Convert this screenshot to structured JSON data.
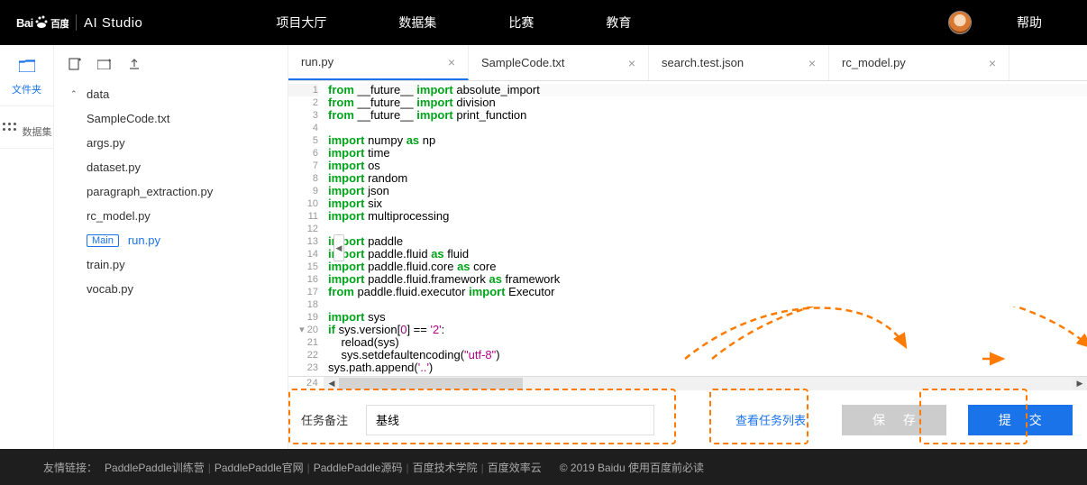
{
  "nav": {
    "logo_baidu": "Bai",
    "logo_baidu2": "百度",
    "logo_studio": "AI Studio",
    "items": [
      "项目大厅",
      "数据集",
      "比赛",
      "教育"
    ],
    "help": "帮助"
  },
  "sidebar_left": {
    "files": "文件夹",
    "datasets": "数据集"
  },
  "file_tree": {
    "folder": "data",
    "files": [
      "SampleCode.txt",
      "args.py",
      "dataset.py",
      "paragraph_extraction.py",
      "rc_model.py",
      "run.py",
      "train.py",
      "vocab.py"
    ],
    "main_badge": "Main",
    "active_index": 5
  },
  "tabs": [
    {
      "label": "run.py",
      "active": true
    },
    {
      "label": "SampleCode.txt",
      "active": false
    },
    {
      "label": "search.test.json",
      "active": false
    },
    {
      "label": "rc_model.py",
      "active": false
    }
  ],
  "code_lines": [
    {
      "n": 1,
      "t": [
        [
          "kw",
          "from"
        ],
        [
          "",
          " __future__ "
        ],
        [
          "kw",
          "import"
        ],
        [
          "",
          " absolute_import"
        ]
      ],
      "hl": true
    },
    {
      "n": 2,
      "t": [
        [
          "kw",
          "from"
        ],
        [
          "",
          " __future__ "
        ],
        [
          "kw",
          "import"
        ],
        [
          "",
          " division"
        ]
      ]
    },
    {
      "n": 3,
      "t": [
        [
          "kw",
          "from"
        ],
        [
          "",
          " __future__ "
        ],
        [
          "kw",
          "import"
        ],
        [
          "",
          " print_function"
        ]
      ]
    },
    {
      "n": 4,
      "t": []
    },
    {
      "n": 5,
      "t": [
        [
          "kw",
          "import"
        ],
        [
          "",
          " numpy "
        ],
        [
          "kw",
          "as"
        ],
        [
          "",
          " np"
        ]
      ]
    },
    {
      "n": 6,
      "t": [
        [
          "kw",
          "import"
        ],
        [
          "",
          " time"
        ]
      ]
    },
    {
      "n": 7,
      "t": [
        [
          "kw",
          "import"
        ],
        [
          "",
          " os"
        ]
      ]
    },
    {
      "n": 8,
      "t": [
        [
          "kw",
          "import"
        ],
        [
          "",
          " random"
        ]
      ]
    },
    {
      "n": 9,
      "t": [
        [
          "kw",
          "import"
        ],
        [
          "",
          " json"
        ]
      ]
    },
    {
      "n": 10,
      "t": [
        [
          "kw",
          "import"
        ],
        [
          "",
          " six"
        ]
      ]
    },
    {
      "n": 11,
      "t": [
        [
          "kw",
          "import"
        ],
        [
          "",
          " multiprocessing"
        ]
      ]
    },
    {
      "n": 12,
      "t": []
    },
    {
      "n": 13,
      "t": [
        [
          "kw",
          "import"
        ],
        [
          "",
          " paddle"
        ]
      ]
    },
    {
      "n": 14,
      "t": [
        [
          "kw",
          "import"
        ],
        [
          "",
          " paddle.fluid "
        ],
        [
          "kw",
          "as"
        ],
        [
          "",
          " fluid"
        ]
      ]
    },
    {
      "n": 15,
      "t": [
        [
          "kw",
          "import"
        ],
        [
          "",
          " paddle.fluid.core "
        ],
        [
          "kw",
          "as"
        ],
        [
          "",
          " core"
        ]
      ]
    },
    {
      "n": 16,
      "t": [
        [
          "kw",
          "import"
        ],
        [
          "",
          " paddle.fluid.framework "
        ],
        [
          "kw",
          "as"
        ],
        [
          "",
          " framework"
        ]
      ]
    },
    {
      "n": 17,
      "t": [
        [
          "kw",
          "from"
        ],
        [
          "",
          " paddle.fluid.executor "
        ],
        [
          "kw",
          "import"
        ],
        [
          "",
          " Executor"
        ]
      ]
    },
    {
      "n": 18,
      "t": []
    },
    {
      "n": 19,
      "t": [
        [
          "kw",
          "import"
        ],
        [
          "",
          " sys"
        ]
      ]
    },
    {
      "n": 20,
      "t": [
        [
          "kw",
          "if"
        ],
        [
          "",
          " sys.version["
        ],
        [
          "num",
          "0"
        ],
        [
          "",
          "] == "
        ],
        [
          "str",
          "'2'"
        ],
        [
          "",
          ":"
        ]
      ],
      "fold": true
    },
    {
      "n": 21,
      "t": [
        [
          "",
          "    reload(sys)"
        ]
      ]
    },
    {
      "n": 22,
      "t": [
        [
          "",
          "    sys.setdefaultencoding("
        ],
        [
          "str",
          "\"utf-8\""
        ],
        [
          "",
          ")"
        ]
      ]
    },
    {
      "n": 23,
      "t": [
        [
          "",
          "sys.path.append("
        ],
        [
          "str",
          "'..'"
        ],
        [
          "",
          ")"
        ]
      ]
    }
  ],
  "hscroll_line": "24",
  "bottom": {
    "task_label": "任务备注",
    "task_value": "基线",
    "view_tasks": "查看任务列表",
    "save": "保 存",
    "submit": "提 交"
  },
  "footer": {
    "friend": "友情链接：",
    "links": [
      "PaddlePaddle训练营",
      "PaddlePaddle官网",
      "PaddlePaddle源码",
      "百度技术学院",
      "百度效率云"
    ],
    "copyright": "© 2019 Baidu 使用百度前必读"
  }
}
